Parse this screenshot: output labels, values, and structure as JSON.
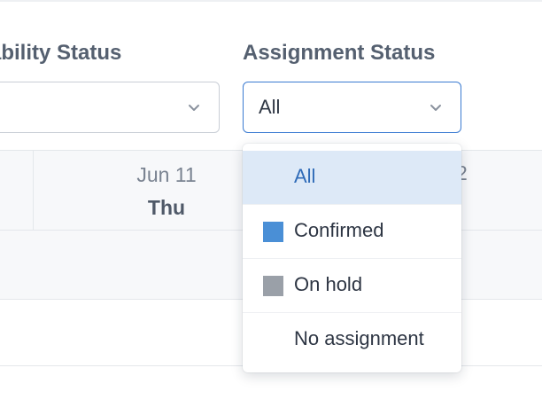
{
  "filters": {
    "availability": {
      "label": "ability Status",
      "value": ""
    },
    "assignment": {
      "label": "Assignment Status",
      "value": "All"
    }
  },
  "schedule": {
    "columns": [
      {
        "date": "Jun 11",
        "day": "Thu"
      },
      {
        "date": "2",
        "day": ""
      }
    ]
  },
  "dropdown": {
    "selected_index": 0,
    "options": [
      {
        "label": "All",
        "swatch": null,
        "swatch_color": null
      },
      {
        "label": "Confirmed",
        "swatch": "square",
        "swatch_color": "#4a8fd6"
      },
      {
        "label": "On hold",
        "swatch": "square",
        "swatch_color": "#9aa0a8"
      },
      {
        "label": "No assignment",
        "swatch": null,
        "swatch_color": null
      }
    ]
  },
  "colors": {
    "accent": "#3b7bd1",
    "selected_bg": "#dde9f7",
    "selected_text": "#2f6bb8"
  },
  "icons": {
    "select_chevron": "chevron-down-icon"
  }
}
